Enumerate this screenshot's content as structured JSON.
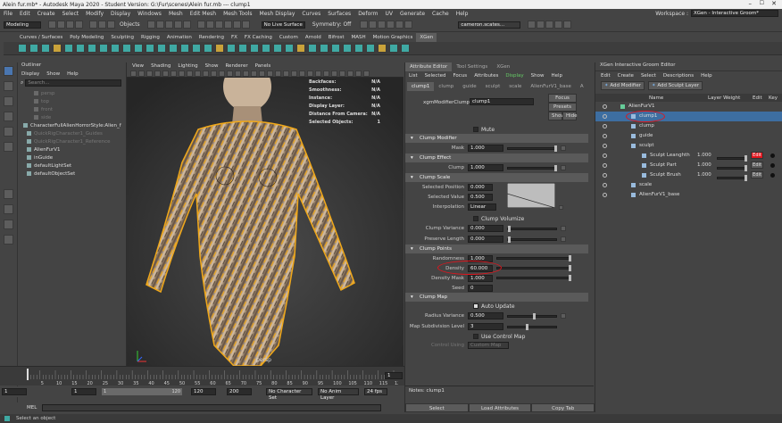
{
  "window": {
    "title": "Alein fur.mb* - Autodesk Maya 2020 - Student Version: G:\\Fur\\scenes\\Alein fur.mb  ---  clump1",
    "workspace_label": "Workspace :",
    "workspace_value": "XGen - Interactive Groom*"
  },
  "main_menu": [
    "File",
    "Edit",
    "Create",
    "Select",
    "Modify",
    "Display",
    "Windows",
    "Mesh",
    "Edit Mesh",
    "Mesh Tools",
    "Mesh Display",
    "Curves",
    "Surfaces",
    "Deform",
    "UV",
    "Generate",
    "Cache",
    "Help"
  ],
  "status_line": {
    "mode": "Modeling",
    "objects": "Objects",
    "live_surface": "No Live Surface",
    "symmetry": "Symmetry: Off",
    "user": "cameron.scates..."
  },
  "shelf_tabs": [
    "Curves / Surfaces",
    "Poly Modeling",
    "Sculpting",
    "Rigging",
    "Animation",
    "Rendering",
    "FX",
    "FX Caching",
    "Custom",
    "Arnold",
    "Bifrost",
    "MASH",
    "Motion Graphics",
    "XGen"
  ],
  "outliner": {
    "title": "Outliner",
    "menu": [
      "Display",
      "Show",
      "Help"
    ],
    "search_placeholder": "Search...",
    "items": [
      "persp",
      "top",
      "front",
      "side",
      "CharacterFullAlienHorrorStyle:Alien_f",
      "QuickRigCharacter1_Guides",
      "QuickRigCharacter1_Reference",
      "AlienFurV1",
      "inGuide",
      "defaultLightSet",
      "defaultObjectSet"
    ]
  },
  "viewport": {
    "menu": [
      "View",
      "Shading",
      "Lighting",
      "Show",
      "Renderer",
      "Panels"
    ],
    "hud": [
      {
        "label": "Backfaces:",
        "value": "N/A"
      },
      {
        "label": "Smoothness:",
        "value": "N/A"
      },
      {
        "label": "Instance:",
        "value": "N/A"
      },
      {
        "label": "Display Layer:",
        "value": "N/A"
      },
      {
        "label": "Distance From Camera:",
        "value": "N/A"
      },
      {
        "label": "Selected Objects:",
        "value": "1"
      }
    ],
    "axis_label": "persp"
  },
  "attribute_editor": {
    "tabs": [
      "Attribute Editor",
      "Tool Settings",
      "XGen"
    ],
    "menu": [
      "List",
      "Selected",
      "Focus",
      "Attributes",
      "Display",
      "Show",
      "Help"
    ],
    "node_tabs": [
      "clump1",
      "clump",
      "guide",
      "sculpt",
      "scale",
      "AlienFurV1_base",
      "A"
    ],
    "node_label": "xgmModifierClump:",
    "node_value": "clump1",
    "focus_btn": "Focus",
    "presets_btn": "Presets",
    "show_btn": "Show",
    "hide_btn": "Hide",
    "mute_label": "Mute",
    "sections": {
      "clump_modifier": "Clump Modifier",
      "clump_effect": "Clump Effect",
      "clump_scale": "Clump Scale",
      "clump_points": "Clump Points",
      "clump_map": "Clump Map"
    },
    "mask": {
      "label": "Mask",
      "value": "1.000"
    },
    "clump": {
      "label": "Clump",
      "value": "1.000"
    },
    "selected_position": {
      "label": "Selected Position",
      "value": "0.000"
    },
    "selected_value": {
      "label": "Selected Value",
      "value": "0.500"
    },
    "interpolation": {
      "label": "Interpolation",
      "value": "Linear"
    },
    "clump_volumize": "Clump Volumize",
    "clump_variance": {
      "label": "Clump Variance",
      "value": "0.000"
    },
    "preserve_length": {
      "label": "Preserve Length",
      "value": "0.000"
    },
    "randomness": {
      "label": "Randomness",
      "value": "1.000"
    },
    "density": {
      "label": "Density",
      "value": "60.000"
    },
    "density_mask": {
      "label": "Density Mask",
      "value": "1.000"
    },
    "seed": {
      "label": "Seed",
      "value": "0"
    },
    "auto_update": "Auto Update",
    "radius_variance": {
      "label": "Radius Variance",
      "value": "0.500"
    },
    "map_subdivision": {
      "label": "Map Subdivision Level",
      "value": "3"
    },
    "use_control_map": "Use Control Map",
    "control_using": {
      "label": "Control Using",
      "value": "Custom Map"
    },
    "notes_label": "Notes: clump1",
    "bottom_buttons": [
      "Select",
      "Load Attributes",
      "Copy Tab"
    ]
  },
  "xgen_editor": {
    "title": "XGen Interactive Groom Editor",
    "menu": [
      "Edit",
      "Create",
      "Select",
      "Descriptions",
      "Help"
    ],
    "add_modifier": "Add Modifier",
    "add_sculpt_layer": "Add Sculpt Layer",
    "columns": [
      "Name",
      "Layer Weight",
      "Edit",
      "Key"
    ],
    "tree": [
      {
        "name": "AlienFurV1",
        "depth": 0,
        "selected": false
      },
      {
        "name": "clump1",
        "depth": 1,
        "selected": true
      },
      {
        "name": "clump",
        "depth": 1,
        "selected": false
      },
      {
        "name": "guide",
        "depth": 1,
        "selected": false
      },
      {
        "name": "sculpt",
        "depth": 1,
        "selected": false
      },
      {
        "name": "Sculpt Leanghth",
        "depth": 2,
        "selected": false,
        "weight": "1.000",
        "edit": "Edit",
        "edit_active": true
      },
      {
        "name": "Sculpt Part",
        "depth": 2,
        "selected": false,
        "weight": "1.000",
        "edit": "Edit",
        "edit_active": false
      },
      {
        "name": "Sculpt Brush",
        "depth": 2,
        "selected": false,
        "weight": "1.000",
        "edit": "Edit",
        "edit_active": false
      },
      {
        "name": "scale",
        "depth": 1,
        "selected": false
      },
      {
        "name": "AlienFurV1_base",
        "depth": 1,
        "selected": false
      }
    ]
  },
  "timeline": {
    "ticks": [
      "5",
      "10",
      "15",
      "20",
      "25",
      "30",
      "35",
      "40",
      "45",
      "50",
      "55",
      "60",
      "65",
      "70",
      "75",
      "80",
      "85",
      "90",
      "95",
      "100",
      "105",
      "110",
      "115",
      "120"
    ],
    "current_frame": "1"
  },
  "range": {
    "start": "1",
    "anim_start": "1",
    "slider_start": "1",
    "slider_end": "120",
    "anim_end": "120",
    "end": "200",
    "character_set": "No Character Set",
    "anim_layer": "No Anim Layer",
    "fps": "24 fps"
  },
  "command_line": {
    "label": "MEL"
  },
  "help_line": "Select an object",
  "colors": {
    "accent_blue": "#3d6ea1",
    "fur_orange": "#f0a81a",
    "red_button": "#e0151d"
  }
}
